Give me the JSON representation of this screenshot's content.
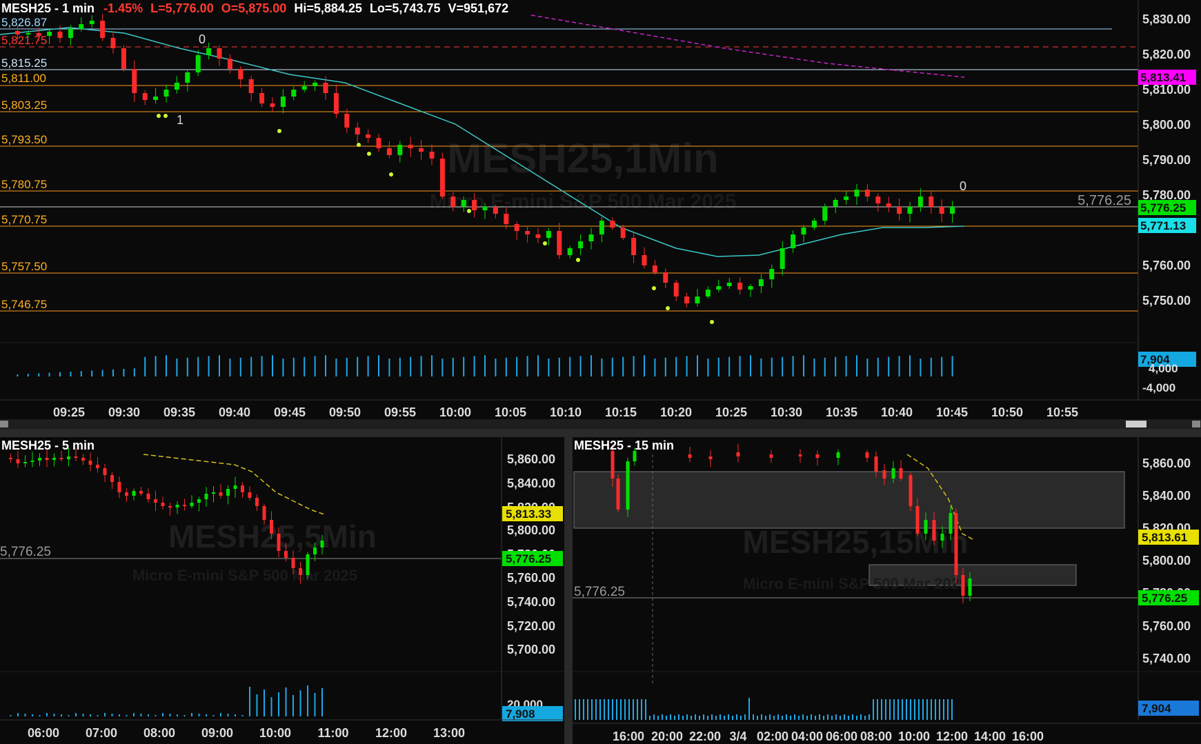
{
  "top_chart": {
    "title": "MESH25 - 1 min",
    "change": "-1.45%",
    "last": "L=5,776.00",
    "open": "O=5,875.00",
    "high": "Hi=5,884.25",
    "low": "Lo=5,743.75",
    "volume": "V=951,672",
    "watermark_symbol": "MESH25,1Min",
    "watermark_desc": "Micro E-mini S&P 500 Mar 2025",
    "price_axis": [
      "5,830.00",
      "5,820.00",
      "5,810.00",
      "5,800.00",
      "5,790.00",
      "5,780.00",
      "5,760.00",
      "5,750.00"
    ],
    "time_axis": [
      "09:25",
      "09:30",
      "09:35",
      "09:40",
      "09:45",
      "09:50",
      "09:55",
      "10:00",
      "10:05",
      "10:10",
      "10:15",
      "10:20",
      "10:25",
      "10:30",
      "10:35",
      "10:40",
      "10:45",
      "10:50",
      "10:55"
    ],
    "levels": [
      {
        "label": "5,826.87",
        "color": "#9fd8ff"
      },
      {
        "label": "5,821.75",
        "color": "#ff3b30"
      },
      {
        "label": "5,815.25",
        "color": "#cde7ff"
      },
      {
        "label": "5,811.00",
        "color": "#ffb020"
      },
      {
        "label": "5,803.25",
        "color": "#ffb020"
      },
      {
        "label": "5,793.50",
        "color": "#ffb020"
      },
      {
        "label": "5,780.75",
        "color": "#ffb020"
      },
      {
        "label": "5,770.75",
        "color": "#ffb020"
      },
      {
        "label": "5,757.50",
        "color": "#ffb020"
      },
      {
        "label": "5,746.75",
        "color": "#ffb020"
      }
    ],
    "current_price_label": "5,776.25",
    "badges": [
      {
        "text": "5,813.41",
        "bg": "#ff00ff",
        "fg": "#111"
      },
      {
        "text": "5,776.25",
        "bg": "#00e000",
        "fg": "#111"
      },
      {
        "text": "5,771.13",
        "bg": "#19e0e8",
        "fg": "#111"
      }
    ],
    "volume_axis": [
      "4,000",
      "-4,000"
    ],
    "volume_badge": "7,904",
    "marker_zero_a": "0",
    "marker_one": "1",
    "marker_zero_b": "0"
  },
  "left_chart": {
    "title": "MESH25 - 5 min",
    "watermark_symbol": "MESH25,5Min",
    "watermark_desc": "Micro E-mini S&P 500 Mar 2025",
    "price_axis": [
      "5,860.00",
      "5,840.00",
      "5,820.00",
      "5,800.00",
      "5,780.00",
      "5,760.00",
      "5,740.00",
      "5,720.00",
      "5,700.00"
    ],
    "current_price_label": "5,776.25",
    "badge_yellow": "5,813.33",
    "badge_green": "5,776.25",
    "volume_axis_label": "20,000",
    "volume_badge": "7,908",
    "time_axis": [
      "06:00",
      "07:00",
      "08:00",
      "09:00",
      "10:00",
      "11:00",
      "12:00",
      "13:00"
    ]
  },
  "right_chart": {
    "title": "MESH25 - 15 min",
    "watermark_symbol": "MESH25,15Min",
    "watermark_desc": "Micro E-mini S&P 500 Mar 2025",
    "price_axis": [
      "5,860.00",
      "5,840.00",
      "5,820.00",
      "5,800.00",
      "5,780.00",
      "5,760.00",
      "5,740.00"
    ],
    "current_price_label": "5,776.25",
    "badge_yellow": "5,813.61",
    "badge_green": "5,776.25",
    "volume_badge": "7,904",
    "time_axis": [
      "16:00",
      "20:00",
      "22:00",
      "3/4",
      "02:00",
      "04:00",
      "06:00",
      "08:00",
      "10:00",
      "12:00",
      "14:00",
      "16:00"
    ]
  }
}
